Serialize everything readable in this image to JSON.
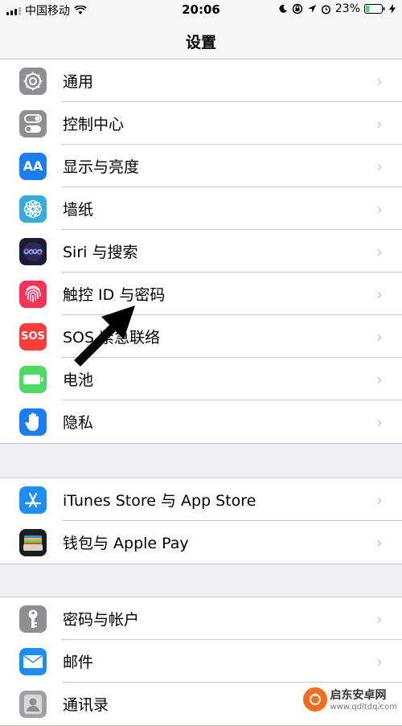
{
  "status_bar": {
    "carrier": "中国移动",
    "time": "20:06",
    "battery_percent": "23%",
    "battery_level": 0.23,
    "battery_color": "#4cd964",
    "icons": [
      "signal-icon",
      "wifi-icon",
      "moon-icon",
      "rotation-lock-icon",
      "location-icon",
      "alarm-icon",
      "battery-icon",
      "charging-icon"
    ]
  },
  "navbar": {
    "title": "设置"
  },
  "groups": [
    {
      "items": [
        {
          "label": "通用",
          "icon": "gear-icon",
          "color": "#8e8e93"
        },
        {
          "label": "控制中心",
          "icon": "toggles-icon",
          "color": "#8e8e93"
        },
        {
          "label": "显示与亮度",
          "icon": "text-size-icon",
          "color": "#1e7cf2"
        },
        {
          "label": "墙纸",
          "icon": "flower-icon",
          "color": "#35aadc"
        },
        {
          "label": "Siri 与搜索",
          "icon": "siri-icon",
          "color": "#1c1c3a"
        },
        {
          "label": "触控 ID 与密码",
          "icon": "fingerprint-icon",
          "color": "#fc3158"
        },
        {
          "label": "SOS 紧急联络",
          "icon": "sos-icon",
          "color": "#fc3d39"
        },
        {
          "label": "电池",
          "icon": "battery-icon",
          "color": "#4cd964"
        },
        {
          "label": "隐私",
          "icon": "hand-icon",
          "color": "#1e7cf2"
        }
      ]
    },
    {
      "items": [
        {
          "label": "iTunes Store 与 App Store",
          "icon": "app-store-icon",
          "color": "#1e8ef5"
        },
        {
          "label": "钱包与 Apple Pay",
          "icon": "wallet-icon",
          "color": "#1c1c1e"
        }
      ]
    },
    {
      "items": [
        {
          "label": "密码与帐户",
          "icon": "key-icon",
          "color": "#8e8e93"
        },
        {
          "label": "邮件",
          "icon": "mail-icon",
          "color": "#1e8ef5"
        },
        {
          "label": "通讯录",
          "icon": "contacts-icon",
          "color": "#a0a0a5"
        }
      ]
    }
  ],
  "watermark": {
    "brand": "启东安卓网",
    "url": "www.qdltdq.com"
  },
  "icon_text": {
    "display": "AA",
    "sos": "SOS"
  },
  "chevron_glyph": "›"
}
